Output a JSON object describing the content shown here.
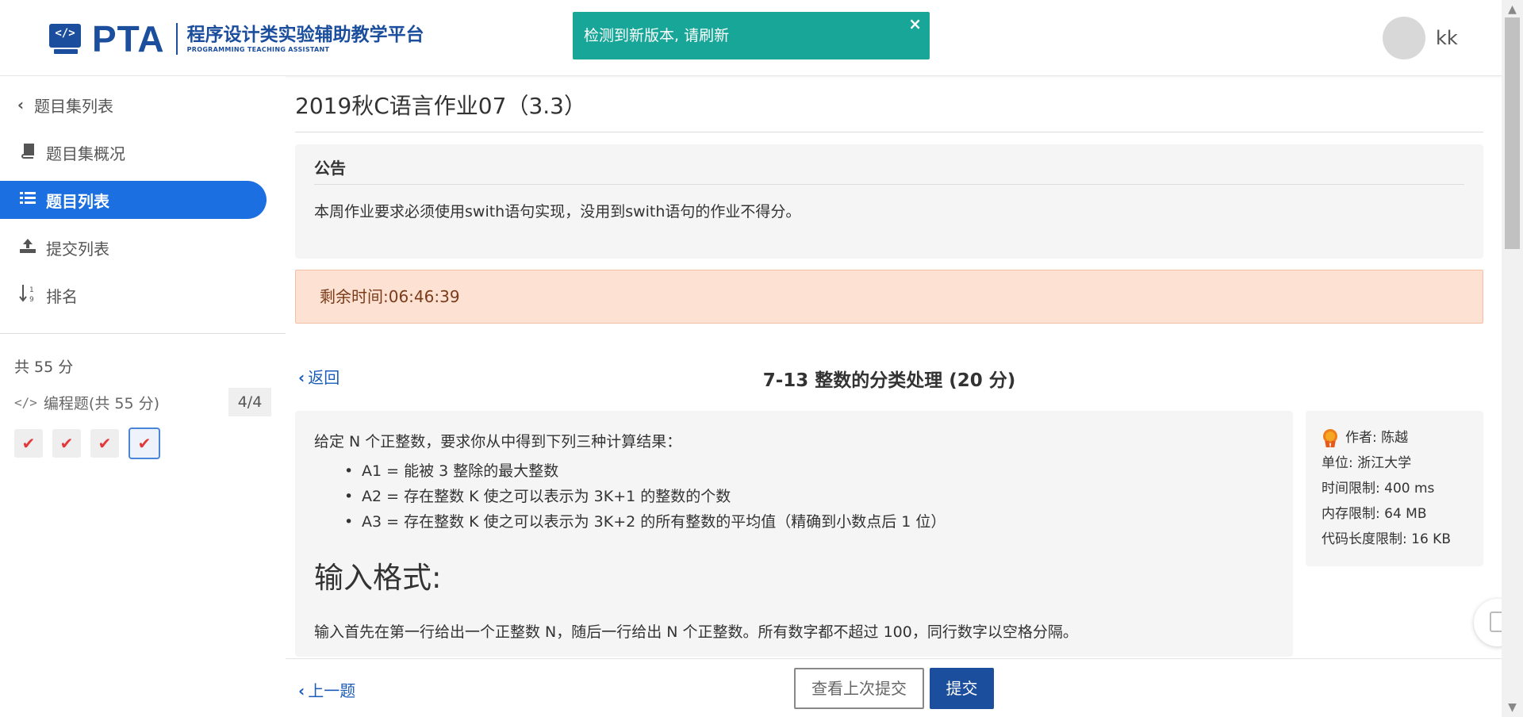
{
  "header": {
    "logo_text": "PTA",
    "logo_code_glyph": "</>",
    "logo_subtitle": "程序设计类实验辅助教学平台",
    "logo_subtitle_en": "PROGRAMMING TEACHING ASSISTANT",
    "username": "kk"
  },
  "toast": {
    "message": "检测到新版本, 请刷新",
    "close": "×"
  },
  "sidebar": {
    "back_label": "题目集列表",
    "items": [
      {
        "label": "题目集概况",
        "icon": "book-icon"
      },
      {
        "label": "题目列表",
        "icon": "list-icon"
      },
      {
        "label": "提交列表",
        "icon": "upload-icon"
      },
      {
        "label": "排名",
        "icon": "sort-numeric-icon"
      }
    ],
    "total_score": "共 55 分",
    "problem_type": "编程题(共 55 分)",
    "problem_count": "4/4",
    "checks": [
      "✔",
      "✔",
      "✔",
      "✔"
    ]
  },
  "main": {
    "title": "2019秋C语言作业07（3.3）",
    "notice_title": "公告",
    "notice_body": "本周作业要求必须使用swith语句实现，没用到swith语句的作业不得分。",
    "timer": "剩余时间:06:46:39",
    "back_label": "返回",
    "problem_title": "7-13 整数的分类处理 (20 分)",
    "problem": {
      "intro": "给定 N 个正整数，要求你从中得到下列三种计算结果：",
      "items": [
        "A1 = 能被 3 整除的最大整数",
        "A2 = 存在整数 K 使之可以表示为 3K+1 的整数的个数",
        "A3 = 存在整数 K 使之可以表示为 3K+2 的所有整数的平均值（精确到小数点后 1 位）"
      ],
      "section_title": "输入格式:",
      "section_body": "输入首先在第一行给出一个正整数 N，随后一行给出 N 个正整数。所有数字都不超过 100，同行数字以空格分隔。"
    },
    "meta": {
      "author": "作者: 陈越",
      "unit": "单位: 浙江大学",
      "time_limit": "时间限制: 400 ms",
      "memory_limit": "内存限制: 64 MB",
      "code_limit": "代码长度限制: 16 KB"
    }
  },
  "bottom": {
    "prev_label": "上一题",
    "last_submission_label": "查看上次提交",
    "submit_label": "提交"
  },
  "colors": {
    "brand": "#1c4e9e",
    "active_nav": "#1b6fe0",
    "toast": "#17a697",
    "timer_bg": "#fde2d3",
    "check": "#e23a3a"
  }
}
